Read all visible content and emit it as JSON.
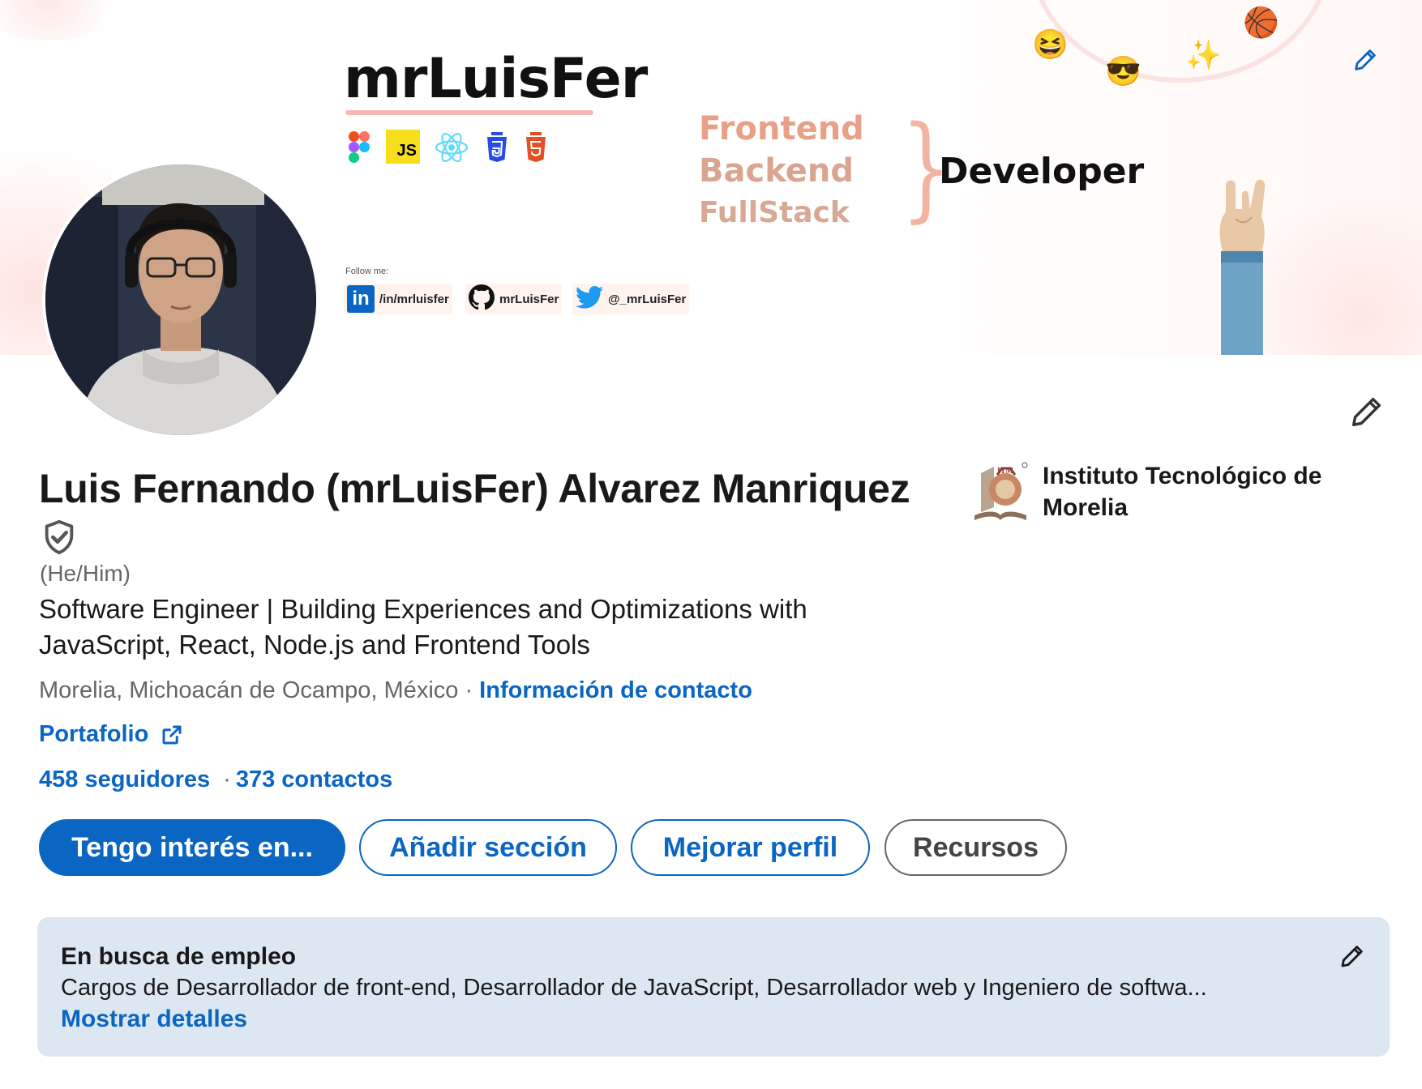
{
  "banner": {
    "brand": "mrLuisFer",
    "tech_icons": [
      "figma-icon",
      "javascript-icon",
      "react-icon",
      "css3-icon",
      "html5-icon"
    ],
    "tech_js_label": "JS",
    "follow_label": "Follow me:",
    "socials": [
      {
        "icon": "linkedin-icon",
        "label": "/in/mrluisfer"
      },
      {
        "icon": "github-icon",
        "label": "mrLuisFer"
      },
      {
        "icon": "twitter-icon",
        "label": "@_mrLuisFer"
      }
    ],
    "linkedin_logo_text": "in",
    "roles": [
      "Frontend",
      "Backend",
      "FullStack"
    ],
    "brace": "}",
    "developer": "Developer",
    "emojis": {
      "laugh": "😆",
      "cool": "😎",
      "sparkle": "✨",
      "ball": "🏀"
    }
  },
  "profile": {
    "name": "Luis Fernando (mrLuisFer) Alvarez Manriquez",
    "pronouns": "(He/Him)",
    "headline": "Software Engineer | Building Experiences and Optimizations with JavaScript, React, Node.js and Frontend Tools",
    "location": "Morelia, Michoacán de Ocampo, México",
    "location_sep": " · ",
    "contact_info": "Información de contacto",
    "portfolio": "Portafolio",
    "followers": "458 seguidores",
    "network_sep": "·",
    "connections": "373 contactos"
  },
  "education": {
    "name": "Instituto Tecnológico de Morelia"
  },
  "actions": {
    "interest": "Tengo interés en...",
    "add_section": "Añadir sección",
    "improve_profile": "Mejorar perfil",
    "resources": "Recursos"
  },
  "open_to_work": {
    "title": "En busca de empleo",
    "description": "Cargos de Desarrollador de front-end, Desarrollador de JavaScript, Desarrollador web y Ingeniero de softwa...",
    "show_details": "Mostrar detalles"
  },
  "colors": {
    "primary": "#0a66c2",
    "text": "#191919",
    "muted": "#666666",
    "card": "#dde7f1"
  }
}
